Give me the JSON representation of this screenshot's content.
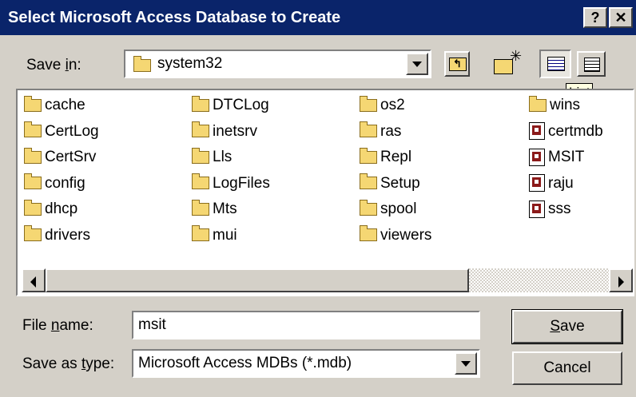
{
  "window": {
    "title": "Select Microsoft Access Database to Create",
    "help_button": "?",
    "close_button": "✕"
  },
  "save_in": {
    "label_pre": "Save ",
    "label_key": "i",
    "label_post": "n:",
    "value": "system32"
  },
  "tooltip": "List",
  "files": {
    "columns": [
      [
        {
          "name": "cache",
          "type": "folder"
        },
        {
          "name": "CertLog",
          "type": "folder"
        },
        {
          "name": "CertSrv",
          "type": "folder"
        },
        {
          "name": "config",
          "type": "folder"
        },
        {
          "name": "dhcp",
          "type": "folder"
        },
        {
          "name": "drivers",
          "type": "folder"
        }
      ],
      [
        {
          "name": "DTCLog",
          "type": "folder"
        },
        {
          "name": "inetsrv",
          "type": "folder"
        },
        {
          "name": "Lls",
          "type": "folder"
        },
        {
          "name": "LogFiles",
          "type": "folder"
        },
        {
          "name": "Mts",
          "type": "folder"
        },
        {
          "name": "mui",
          "type": "folder"
        }
      ],
      [
        {
          "name": "os2",
          "type": "folder"
        },
        {
          "name": "ras",
          "type": "folder"
        },
        {
          "name": "Repl",
          "type": "folder"
        },
        {
          "name": "Setup",
          "type": "folder"
        },
        {
          "name": "spool",
          "type": "folder"
        },
        {
          "name": "viewers",
          "type": "folder"
        }
      ],
      [
        {
          "name": "wins",
          "type": "folder"
        },
        {
          "name": "certmdb",
          "type": "mdb"
        },
        {
          "name": "MSIT",
          "type": "mdb"
        },
        {
          "name": "raju",
          "type": "mdb"
        },
        {
          "name": "sss",
          "type": "mdb"
        }
      ]
    ]
  },
  "file_name": {
    "label_pre": "File ",
    "label_key": "n",
    "label_post": "ame:",
    "value": "msit"
  },
  "save_as_type": {
    "label_pre": "Save as ",
    "label_key": "t",
    "label_post": "ype:",
    "value": "Microsoft Access MDBs (*.mdb)"
  },
  "buttons": {
    "save_key": "S",
    "save_rest": "ave",
    "cancel": "Cancel"
  }
}
